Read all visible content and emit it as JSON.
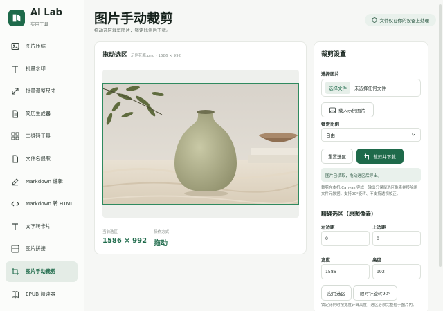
{
  "app": {
    "name": "AI Lab",
    "subtitle": "实用工具"
  },
  "sidebar": {
    "items": [
      {
        "label": "图片压缩",
        "icon": "image-icon"
      },
      {
        "label": "批量水印",
        "icon": "text-t-icon"
      },
      {
        "label": "批量调整尺寸",
        "icon": "resize-icon"
      },
      {
        "label": "简历生成器",
        "icon": "document-icon"
      },
      {
        "label": "二维码工具",
        "icon": "qr-grid-icon"
      },
      {
        "label": "文件名提取",
        "icon": "file-icon"
      },
      {
        "label": "Markdown 编辑",
        "icon": "pen-icon"
      },
      {
        "label": "Markdown 转 HTML",
        "icon": "code-icon"
      },
      {
        "label": "文字转卡片",
        "icon": "text-t-icon"
      },
      {
        "label": "图片拼接",
        "icon": "image-grid-icon"
      },
      {
        "label": "图片手动裁剪",
        "icon": "crop-icon",
        "active": true
      },
      {
        "label": "EPUB 阅读器",
        "icon": "book-icon"
      }
    ]
  },
  "header": {
    "title": "图片手动裁剪",
    "subtitle": "拖动选区裁剪图片，锁定比例后下载。",
    "privacy": "文件仅在你的设备上处理"
  },
  "preview": {
    "title": "拖动选区",
    "file_meta": "示例花瓶.png · 1586 × 992",
    "current_label": "当前选区",
    "current_value": "1586 × 992",
    "mode_label": "操作方式",
    "mode_value": "拖动"
  },
  "settings": {
    "title": "裁剪设置",
    "choose_label": "选择图片",
    "choose_button": "选择文件",
    "no_file": "未选择任何文件",
    "load_sample": "载入示例图片",
    "ratio_label": "锁定比例",
    "ratio_value": "自由",
    "reset_button": "重置选区",
    "crop_button": "裁剪并下载",
    "status": "图片已读取，拖动选区后导出。",
    "note": "裁剪在本机 Canvas 完成，输出只保留选区像素并移除原文件元数据，支持90°旋转、不支持透视校正。",
    "precise_title": "精确选区（原图像素）",
    "left_label": "左边距",
    "left_value": "0",
    "top_label": "上边距",
    "top_value": "0",
    "width_label": "宽度",
    "width_value": "1586",
    "height_label": "高度",
    "height_value": "992",
    "apply_button": "应用选区",
    "rotate_button": "顺时针旋转90°",
    "footer_note": "锁定比例时按宽度计算高度，选区必须完整位于图片内。"
  },
  "colors": {
    "accent": "#1e6a4a",
    "accent_soft": "#e9f1ec"
  }
}
